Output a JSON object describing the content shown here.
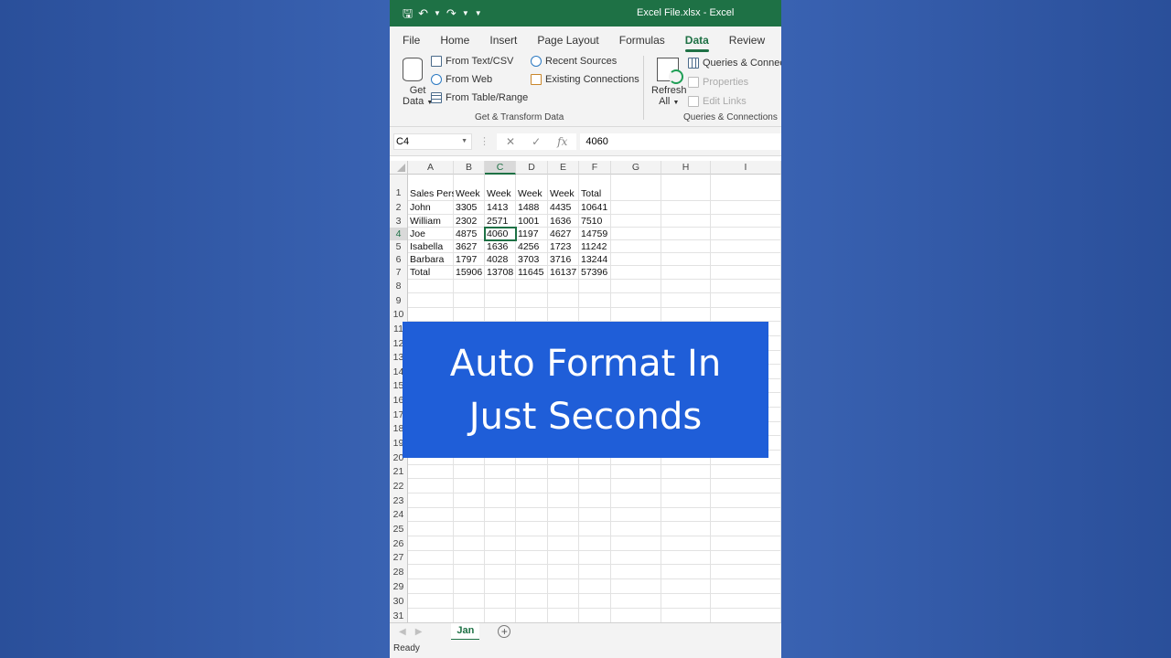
{
  "window": {
    "title": "Excel File.xlsx  -  Excel"
  },
  "quick_access": {
    "icons": [
      "save-icon",
      "undo-icon",
      "redo-icon",
      "customize-icon"
    ]
  },
  "tabs": [
    "File",
    "Home",
    "Insert",
    "Page Layout",
    "Formulas",
    "Data",
    "Review",
    "V"
  ],
  "active_tab": "Data",
  "ribbon": {
    "get_data": {
      "line1": "Get",
      "line2": "Data"
    },
    "from_text_csv": "From Text/CSV",
    "from_web": "From Web",
    "from_table_range": "From Table/Range",
    "recent_sources": "Recent Sources",
    "existing_connections": "Existing Connections",
    "group_get_transform": "Get & Transform Data",
    "refresh": {
      "line1": "Refresh",
      "line2": "All"
    },
    "queries_connections": "Queries & Connections",
    "properties": "Properties",
    "edit_links": "Edit Links",
    "group_queries": "Queries & Connections"
  },
  "formula_bar": {
    "name_box": "C4",
    "formula": "4060",
    "fx": "fx"
  },
  "columns": [
    "A",
    "B",
    "C",
    "D",
    "E",
    "F",
    "G",
    "H",
    "I"
  ],
  "selected_column": "C",
  "selected_row": 4,
  "rows": [
    "1",
    "2",
    "3",
    "4",
    "5",
    "6",
    "7",
    "8",
    "9",
    "10",
    "11",
    "12",
    "13",
    "14",
    "15",
    "16",
    "17",
    "18",
    "19",
    "20",
    "21",
    "22",
    "23",
    "24",
    "25",
    "26",
    "27",
    "28",
    "29",
    "30",
    "31"
  ],
  "cells": [
    [
      "Sales Pers",
      "Week",
      "Week",
      "Week",
      "Week",
      "Total"
    ],
    [
      "John",
      "3305",
      "1413",
      "1488",
      "4435",
      "10641"
    ],
    [
      "William",
      "2302",
      "2571",
      "1001",
      "1636",
      "7510"
    ],
    [
      "Joe",
      "4875",
      "4060",
      "1197",
      "4627",
      "14759"
    ],
    [
      "Isabella",
      "3627",
      "1636",
      "4256",
      "1723",
      "11242"
    ],
    [
      "Barbara",
      "1797",
      "4028",
      "3703",
      "3716",
      "13244"
    ],
    [
      "Total",
      "15906",
      "13708",
      "11645",
      "16137",
      "57396"
    ]
  ],
  "banner": {
    "line1": "Auto Format In",
    "line2": "Just Seconds"
  },
  "sheet_tabs": [
    "Jan"
  ],
  "status": "Ready",
  "colors": {
    "excel_green": "#1e7145",
    "banner_blue": "#1f5ed8"
  }
}
